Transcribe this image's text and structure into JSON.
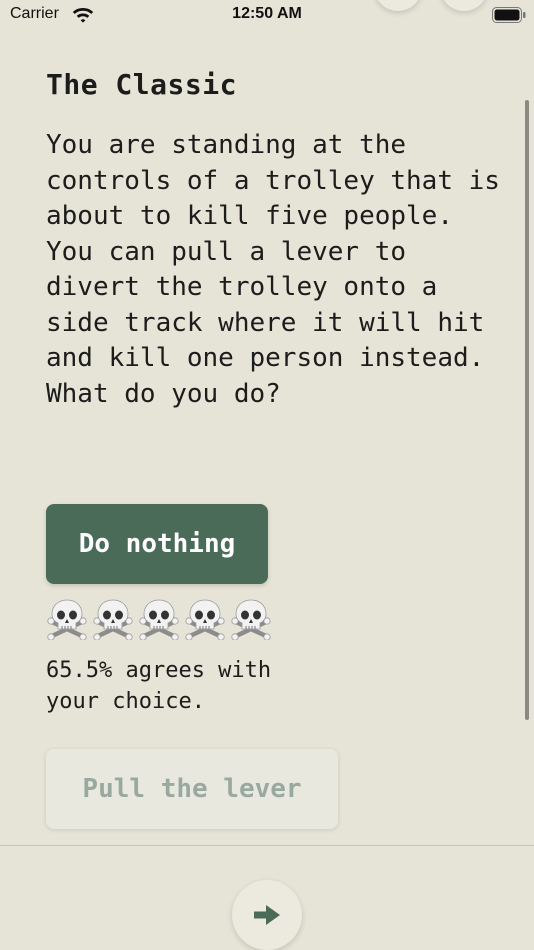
{
  "status_bar": {
    "carrier": "Carrier",
    "time": "12:50 AM",
    "icons": [
      "wifi-icon",
      "battery-icon"
    ]
  },
  "dilemma": {
    "title": "The Classic",
    "question": "You are standing at the controls of a trolley that is about to kill five people. You can pull a lever to divert the trolley onto a side track where it will hit and kill one person instead. What do you do?"
  },
  "choices": {
    "selected": {
      "label": "Do nothing",
      "victims_count": 5,
      "victim_icon": "skull-and-crossbones-icon",
      "agreement_text": "65.5% agrees with your choice."
    },
    "other": {
      "label": "Pull the lever"
    }
  },
  "navigation": {
    "next_icon": "right-arrow-icon"
  },
  "colors": {
    "background": "#e6e4d6",
    "accent": "#4a6b58",
    "disabled_text": "#9aa9a0",
    "text": "#1c1c1c"
  }
}
